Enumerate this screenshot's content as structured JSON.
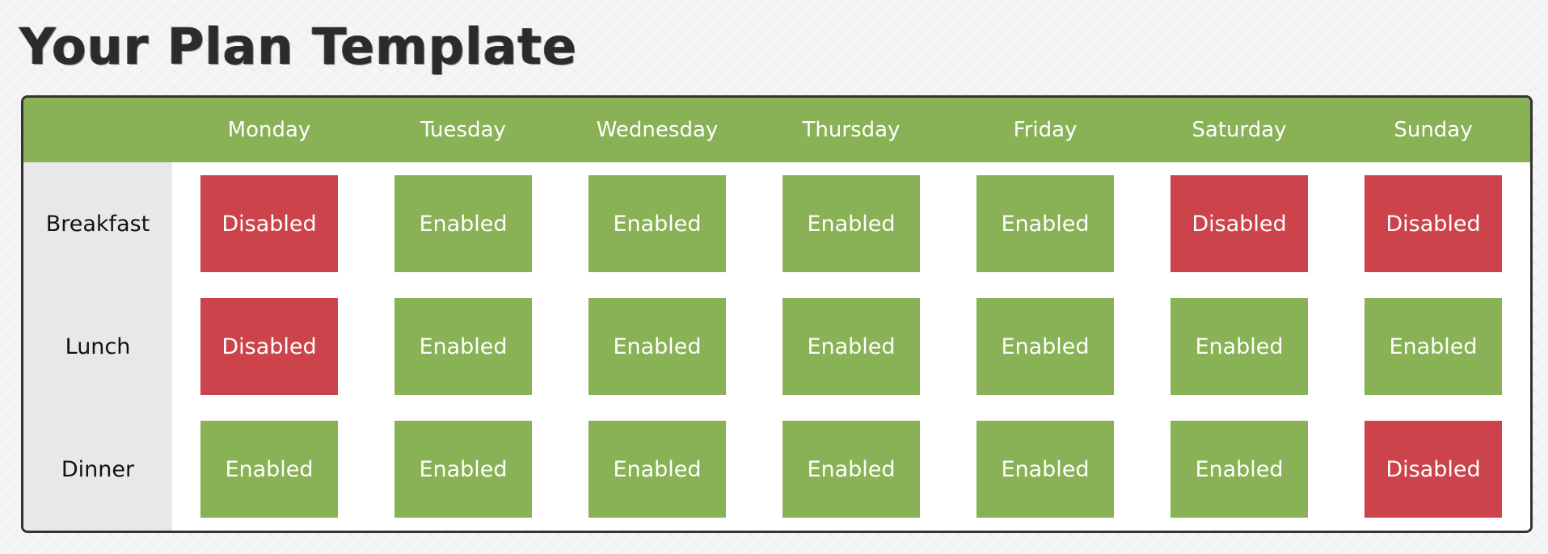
{
  "page_title": "Your Plan Template",
  "colors": {
    "enabled": "#89b155",
    "disabled": "#cc434b",
    "header": "#89b155",
    "meal_column": "#e8e8e8"
  },
  "days": [
    "Monday",
    "Tuesday",
    "Wednesday",
    "Thursday",
    "Friday",
    "Saturday",
    "Sunday"
  ],
  "meals": [
    {
      "label": "Breakfast",
      "slots": [
        "Disabled",
        "Enabled",
        "Enabled",
        "Enabled",
        "Enabled",
        "Disabled",
        "Disabled"
      ]
    },
    {
      "label": "Lunch",
      "slots": [
        "Disabled",
        "Enabled",
        "Enabled",
        "Enabled",
        "Enabled",
        "Enabled",
        "Enabled"
      ]
    },
    {
      "label": "Dinner",
      "slots": [
        "Enabled",
        "Enabled",
        "Enabled",
        "Enabled",
        "Enabled",
        "Enabled",
        "Disabled"
      ]
    }
  ]
}
